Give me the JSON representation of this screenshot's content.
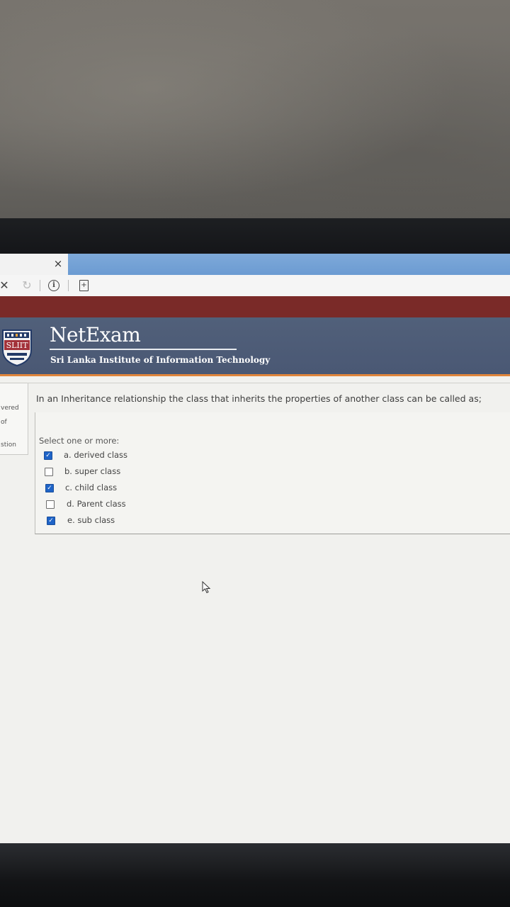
{
  "browser": {
    "tab_close_glyph": "×",
    "stop_glyph": "✕",
    "reload_glyph": "↻",
    "info_glyph": "i",
    "page_glyph": "+"
  },
  "site": {
    "brand_title": "NetExam",
    "brand_subtitle": "Sri Lanka Institute of Information Technology",
    "logo_text": "SLIIT",
    "colors": {
      "header_red": "#7a2a28",
      "header_blue": "#4f5e78",
      "accent_orange": "#e0853b",
      "checkbox_blue": "#1e63c7"
    }
  },
  "info_panel": {
    "line1": "vered",
    "line2": "of",
    "line3": "stion"
  },
  "question": {
    "text": "In an Inheritance relationship the class that inherits the properties of another class can be called as;",
    "prompt": "Select one or more:",
    "options": [
      {
        "label": "a. derived class",
        "checked": true
      },
      {
        "label": "b. super class",
        "checked": false
      },
      {
        "label": "c. child class",
        "checked": true
      },
      {
        "label": "d. Parent class",
        "checked": false
      },
      {
        "label": "e. sub class",
        "checked": true
      }
    ]
  }
}
